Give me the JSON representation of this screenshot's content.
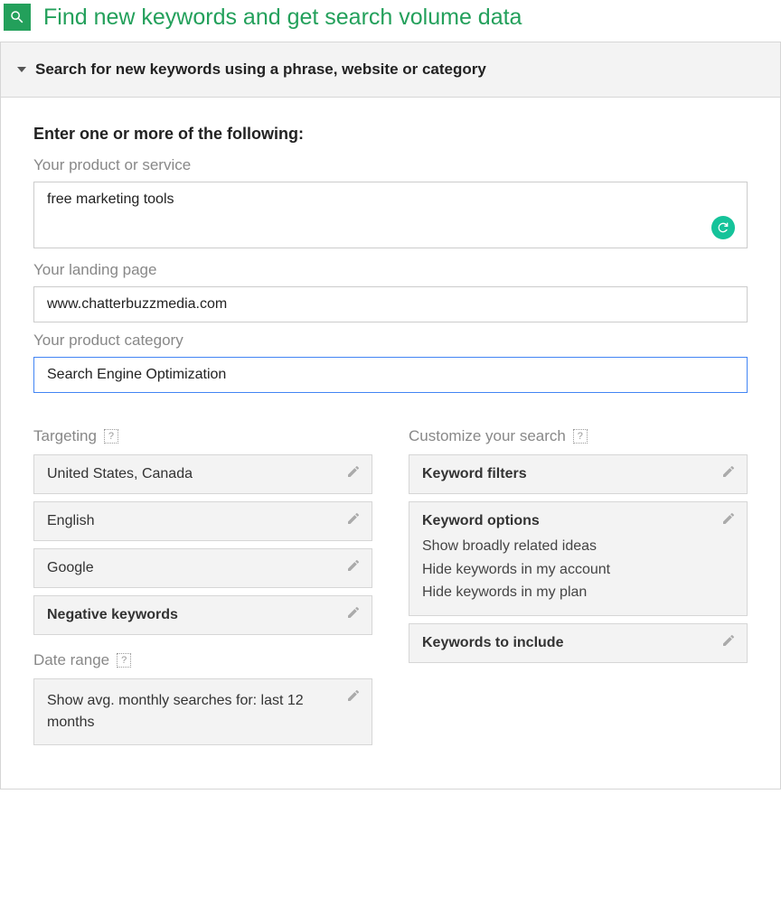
{
  "header": {
    "title": "Find new keywords and get search volume data"
  },
  "accordion": {
    "title": "Search for new keywords using a phrase, website or category"
  },
  "form": {
    "section_heading": "Enter one or more of the following:",
    "product_service": {
      "label": "Your product or service",
      "value": "free marketing tools"
    },
    "landing_page": {
      "label": "Your landing page",
      "value": "www.chatterbuzzmedia.com"
    },
    "product_category": {
      "label": "Your product category",
      "value": "Search Engine Optimization"
    }
  },
  "targeting": {
    "label": "Targeting",
    "location": "United States, Canada",
    "language": "English",
    "network": "Google",
    "negative_keywords": "Negative keywords"
  },
  "date_range": {
    "label": "Date range",
    "value": "Show avg. monthly searches for: last 12 months"
  },
  "customize": {
    "label": "Customize your search",
    "keyword_filters": "Keyword filters",
    "keyword_options": {
      "title": "Keyword options",
      "lines": [
        "Show broadly related ideas",
        "Hide keywords in my account",
        "Hide keywords in my plan"
      ]
    },
    "keywords_include": "Keywords to include"
  },
  "help_glyph": "?"
}
